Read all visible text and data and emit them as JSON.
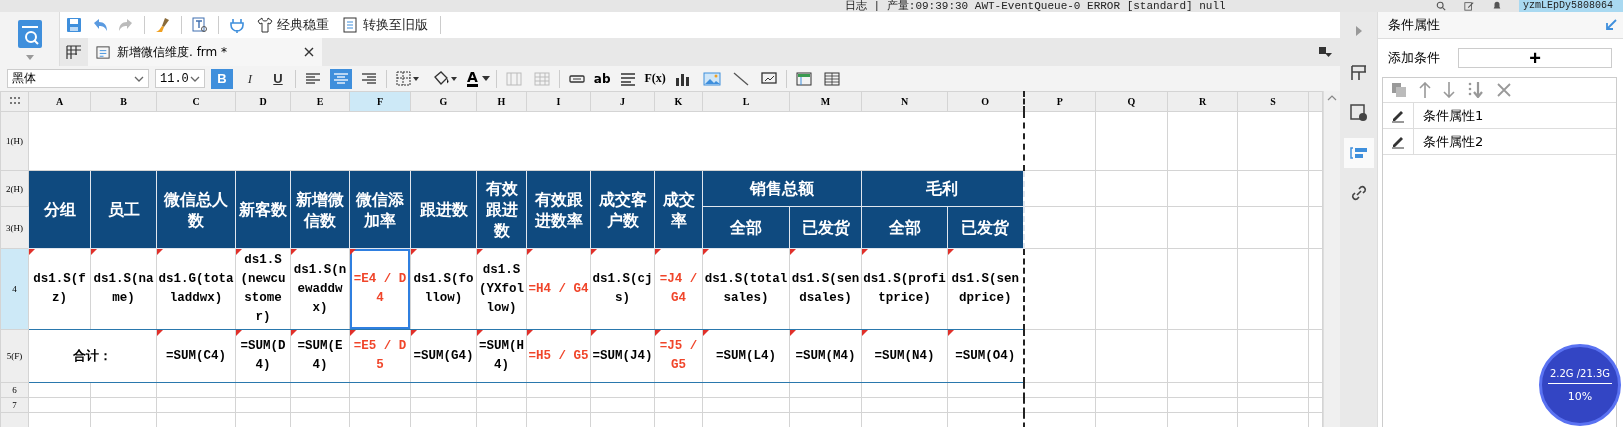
{
  "status_bar": {
    "log": "日志 | 产量:09:39:30 AWT-EventQueue-0 ERROR [standard] null",
    "user": "yzmLEpDy5808064"
  },
  "toolbar": {
    "theme_button": "经典稳重",
    "convert_button": "转换至旧版"
  },
  "tabs": [
    {
      "label": "新增微信维度. frm *",
      "selected": true
    }
  ],
  "format_bar": {
    "font": "黑体",
    "size": "11.0",
    "styles": [
      {
        "kind": "bold",
        "label": "B",
        "on": true
      },
      {
        "kind": "italic",
        "label": "I",
        "on": false
      },
      {
        "kind": "underline",
        "label": "U",
        "on": false
      }
    ],
    "align": [
      {
        "kind": "left",
        "selected": false
      },
      {
        "kind": "center",
        "selected": true
      },
      {
        "kind": "right",
        "selected": false
      }
    ],
    "font_color_label": "A",
    "text_tool": "ab",
    "formula_tool": "F(x)"
  },
  "sheet": {
    "columns": [
      {
        "label": "A",
        "selected": false
      },
      {
        "label": "B",
        "selected": false
      },
      {
        "label": "C",
        "selected": false
      },
      {
        "label": "D",
        "selected": false
      },
      {
        "label": "E",
        "selected": false
      },
      {
        "label": "F",
        "selected": true
      },
      {
        "label": "G",
        "selected": false
      },
      {
        "label": "H",
        "selected": false
      },
      {
        "label": "I",
        "selected": false
      },
      {
        "label": "J",
        "selected": false
      },
      {
        "label": "K",
        "selected": false
      },
      {
        "label": "L",
        "selected": false
      },
      {
        "label": "M",
        "selected": false
      },
      {
        "label": "N",
        "selected": false
      },
      {
        "label": "O",
        "selected": false
      },
      {
        "label": "P",
        "selected": false
      },
      {
        "label": "Q",
        "selected": false
      },
      {
        "label": "R",
        "selected": false
      },
      {
        "label": "S",
        "selected": false
      }
    ],
    "rows": [
      {
        "label": "1(H)",
        "selected": false
      },
      {
        "label": "2(H)",
        "selected": false
      },
      {
        "label": "3(H)",
        "selected": false
      },
      {
        "label": "4",
        "selected": true
      },
      {
        "label": "5(F)",
        "selected": false
      },
      {
        "label": "6",
        "selected": false
      },
      {
        "label": "7",
        "selected": false
      }
    ],
    "headers": [
      {
        "text": "分组"
      },
      {
        "text": "员工"
      },
      {
        "text": "微信总人数"
      },
      {
        "text": "新客数"
      },
      {
        "text": "新增微信数"
      },
      {
        "text": "微信添加率"
      },
      {
        "text": "跟进数"
      },
      {
        "text": "有效跟进数"
      },
      {
        "text": "有效跟进数率"
      },
      {
        "text": "成交客户数"
      },
      {
        "text": "成交率"
      },
      {
        "text": "销售总额",
        "children": [
          {
            "text": "全部"
          },
          {
            "text": "已发货"
          }
        ]
      },
      {
        "text": "毛利",
        "children": [
          {
            "text": "全部"
          },
          {
            "text": "已发货"
          }
        ]
      }
    ],
    "detail_row": [
      {
        "text": "ds1.S(fz)",
        "color": "#000000",
        "flag": true,
        "selected": false
      },
      {
        "text": "ds1.S(name)",
        "color": "#000000",
        "flag": true,
        "selected": false
      },
      {
        "text": "ds1.G(totaladdwx)",
        "color": "#000000",
        "flag": true,
        "selected": false
      },
      {
        "text": "ds1.S(newcustomer)",
        "color": "#000000",
        "flag": true,
        "selected": false
      },
      {
        "text": "ds1.S(newaddwx)",
        "color": "#000000",
        "flag": true,
        "selected": false
      },
      {
        "text": "=E4 / D4",
        "color": "#f0452a",
        "flag": true,
        "selected": true
      },
      {
        "text": "ds1.S(follow)",
        "color": "#000000",
        "flag": true,
        "selected": false
      },
      {
        "text": "ds1.S(YXfollow)",
        "color": "#000000",
        "flag": true,
        "selected": false
      },
      {
        "text": "=H4 / G4",
        "color": "#f0452a",
        "flag": true,
        "selected": false
      },
      {
        "text": "ds1.S(cjs)",
        "color": "#000000",
        "flag": true,
        "selected": false
      },
      {
        "text": "=J4 / G4",
        "color": "#f0452a",
        "flag": true,
        "selected": false
      },
      {
        "text": "ds1.S(totalsales)",
        "color": "#000000",
        "flag": true,
        "selected": false
      },
      {
        "text": "ds1.S(sendsales)",
        "color": "#000000",
        "flag": true,
        "selected": false
      },
      {
        "text": "ds1.S(profitprice)",
        "color": "#000000",
        "flag": true,
        "selected": false
      },
      {
        "text": "ds1.S(sendprice)",
        "color": "#000000",
        "flag": true,
        "selected": false
      }
    ],
    "total_row": {
      "label": "合计：",
      "cells": [
        {
          "text": "=SUM(C4)",
          "color": "#000000",
          "flag": true,
          "selected": false
        },
        {
          "text": "=SUM(D4)",
          "color": "#000000",
          "flag": true,
          "selected": false
        },
        {
          "text": "=SUM(E4)",
          "color": "#000000",
          "flag": true,
          "selected": false
        },
        {
          "text": "=E5 / D5",
          "color": "#f0452a",
          "flag": true,
          "selected": false
        },
        {
          "text": "=SUM(G4)",
          "color": "#000000",
          "flag": true,
          "selected": false
        },
        {
          "text": "=SUM(H4)",
          "color": "#000000",
          "flag": true,
          "selected": false
        },
        {
          "text": "=H5 / G5",
          "color": "#f0452a",
          "flag": true,
          "selected": false
        },
        {
          "text": "=SUM(J4)",
          "color": "#000000",
          "flag": true,
          "selected": false
        },
        {
          "text": "=J5 / G5",
          "color": "#f0452a",
          "flag": true,
          "selected": false
        },
        {
          "text": "=SUM(L4)",
          "color": "#000000",
          "flag": true,
          "selected": false
        },
        {
          "text": "=SUM(M4)",
          "color": "#000000",
          "flag": true,
          "selected": false
        },
        {
          "text": "=SUM(N4)",
          "color": "#000000",
          "flag": true,
          "selected": false
        },
        {
          "text": "=SUM(O4)",
          "color": "#000000",
          "flag": true,
          "selected": false
        }
      ]
    }
  },
  "side_tabs": [
    {
      "selected": false
    },
    {
      "selected": false
    },
    {
      "selected": true
    },
    {
      "selected": false
    }
  ],
  "panel": {
    "title": "条件属性",
    "add_label": "添加条件",
    "add_button": "+",
    "conditions": [
      {
        "label": "条件属性1"
      },
      {
        "label": "条件属性2"
      }
    ]
  },
  "memory": {
    "usage": "2.2G /21.3G",
    "percent": "10%"
  }
}
